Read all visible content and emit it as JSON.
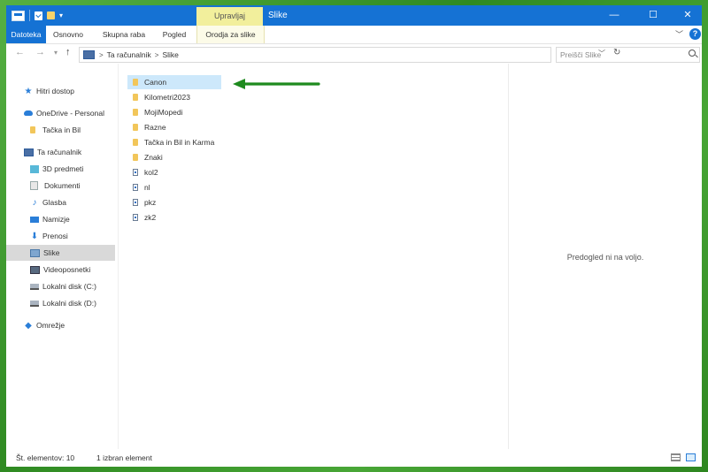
{
  "titlebar": {
    "manage_tab": "Upravljaj",
    "title": "Slike",
    "minimize": "—",
    "maximize": "☐",
    "close": "✕"
  },
  "ribbon": {
    "tabs": [
      {
        "label": "Datoteka"
      },
      {
        "label": "Osnovno"
      },
      {
        "label": "Skupna raba"
      },
      {
        "label": "Pogled"
      },
      {
        "label": "Orodja za slike"
      }
    ],
    "help": "?"
  },
  "address": {
    "crumbs": [
      "Ta računalnik",
      "Slike"
    ],
    "separator": ">"
  },
  "search": {
    "placeholder": "Preišči Slike"
  },
  "navpane": {
    "items": [
      {
        "label": "Hitri dostop",
        "icon": "star-icon"
      },
      {
        "label": "OneDrive - Personal",
        "icon": "cloud-icon"
      },
      {
        "label": "Tačka in Bil",
        "icon": "folder-icon"
      },
      {
        "label": "Ta računalnik",
        "icon": "computer-icon"
      },
      {
        "label": "3D predmeti",
        "icon": "3d-objects-icon"
      },
      {
        "label": "Dokumenti",
        "icon": "documents-icon"
      },
      {
        "label": "Glasba",
        "icon": "music-icon"
      },
      {
        "label": "Namizje",
        "icon": "desktop-icon"
      },
      {
        "label": "Prenosi",
        "icon": "downloads-icon"
      },
      {
        "label": "Slike",
        "icon": "pictures-icon"
      },
      {
        "label": "Videoposnetki",
        "icon": "videos-icon"
      },
      {
        "label": "Lokalni disk (C:)",
        "icon": "disk-icon"
      },
      {
        "label": "Lokalni disk (D:)",
        "icon": "disk-icon"
      },
      {
        "label": "Omrežje",
        "icon": "network-icon"
      }
    ],
    "selected": "Slike"
  },
  "files": {
    "items": [
      {
        "name": "Canon",
        "type": "folder"
      },
      {
        "name": "Kilometri2023",
        "type": "folder"
      },
      {
        "name": "MojiMopedi",
        "type": "folder"
      },
      {
        "name": "Razne",
        "type": "folder"
      },
      {
        "name": "Tačka in Bil in Karma",
        "type": "folder"
      },
      {
        "name": "Znaki",
        "type": "folder"
      },
      {
        "name": "kol2",
        "type": "file"
      },
      {
        "name": "nl",
        "type": "file"
      },
      {
        "name": "pkz",
        "type": "file"
      },
      {
        "name": "zk2",
        "type": "file"
      }
    ],
    "selected": "Canon"
  },
  "preview": {
    "message": "Predogled ni na voljo."
  },
  "status": {
    "count": "Št. elementov: 10",
    "selection": "1 izbran element"
  },
  "colors": {
    "accent": "#1572d4",
    "manage_tab": "#f2ef9c",
    "selection": "#cde8fb",
    "arrow": "#1e8a1e",
    "frame": "#3f9a2e"
  }
}
